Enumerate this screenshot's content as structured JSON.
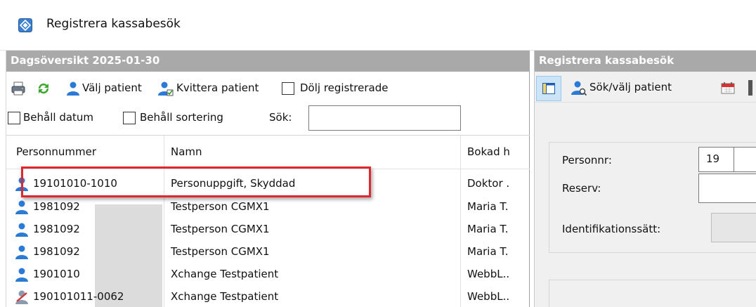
{
  "window": {
    "title": "Registrera kassabesök",
    "icon": "app-diamond-icon"
  },
  "left_pane": {
    "header": "Dagsöversikt 2025-01-30",
    "toolbar": {
      "select_patient_label": "Välj patient",
      "receipt_patient_label": "Kvittera patient",
      "hide_registered_label": "Dölj registrerade",
      "hide_registered_checked": false
    },
    "filters": {
      "keep_date_label": "Behåll datum",
      "keep_date_checked": false,
      "keep_sort_label": "Behåll sortering",
      "keep_sort_checked": false,
      "search_label": "Sök:",
      "search_value": ""
    },
    "columns": [
      "Personnummer",
      "Namn",
      "Bokad h"
    ],
    "rows": [
      {
        "personnummer": "19101010-1010",
        "namn": "Personuppgift, Skyddad",
        "bokad": "Doktor .",
        "icon": "person-icon",
        "highlighted": true
      },
      {
        "personnummer": "1981092",
        "namn": "Testperson CGMX1",
        "bokad": "Maria T.",
        "icon": "person-icon",
        "highlighted": false
      },
      {
        "personnummer": "1981092",
        "namn": "Testperson CGMX1",
        "bokad": "Maria T.",
        "icon": "person-icon",
        "highlighted": false
      },
      {
        "personnummer": "1981092",
        "namn": "Testperson CGMX1",
        "bokad": "Maria T.",
        "icon": "person-icon",
        "highlighted": false
      },
      {
        "personnummer": "1901010",
        "namn": "Xchange Testpatient",
        "bokad": "WebbL..",
        "icon": "person-icon",
        "highlighted": false
      },
      {
        "personnummer": "190101011-0062",
        "namn": "Xchange Testpatient",
        "bokad": "WebbL..",
        "icon": "person-checked-icon",
        "highlighted": false
      }
    ]
  },
  "right_pane": {
    "header": "Registrera kassabesök",
    "toolbar": {
      "search_patient_label": "Sök/välj patient"
    },
    "form": {
      "personnr_label": "Personnr:",
      "personnr_value": "19",
      "reserv_label": "Reserv:",
      "reserv_value": "",
      "identification_label": "Identifikationssätt:"
    }
  },
  "colors": {
    "pane_header_bg": "#a9a9a9",
    "highlight_border": "#e0262e",
    "person_icon": "#2b7bd6"
  }
}
